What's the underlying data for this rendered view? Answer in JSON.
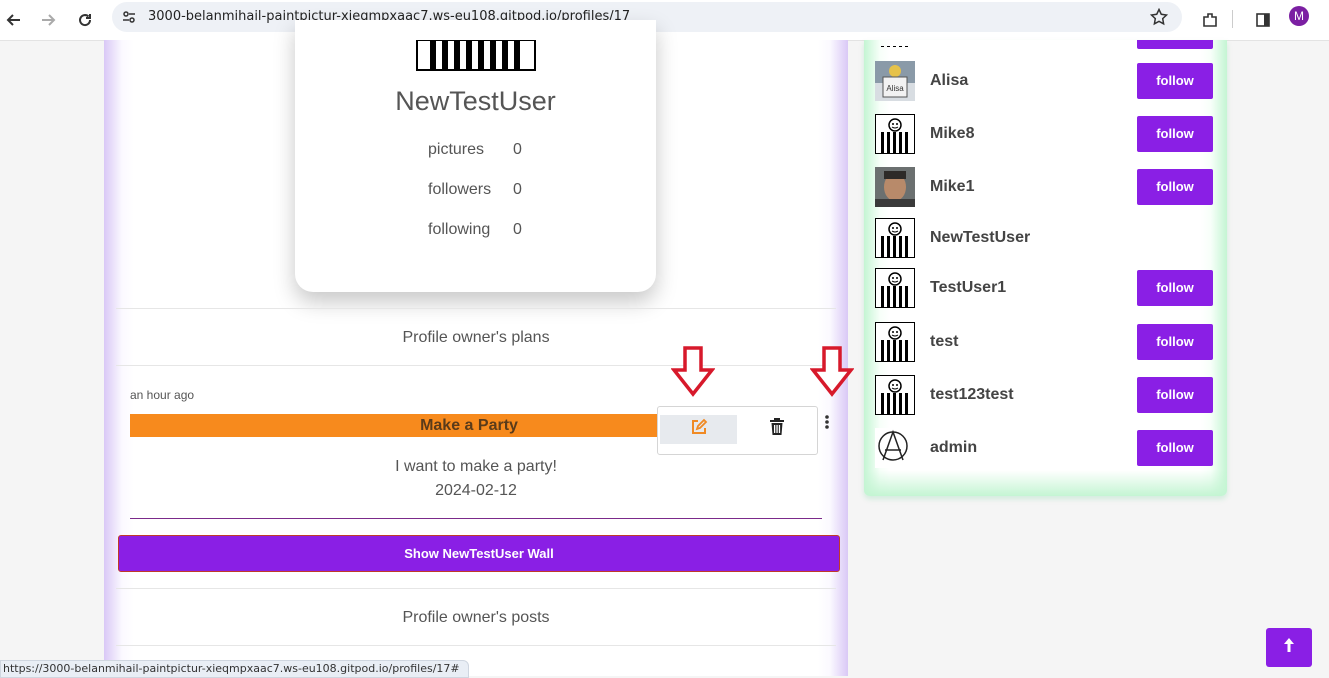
{
  "browser": {
    "url": "3000-belanmihail-paintpictur-xieqmpxaac7.ws-eu108.gitpod.io/profiles/17",
    "profile_initial": "M",
    "status_url": "https://3000-belanmihail-paintpictur-xieqmpxaac7.ws-eu108.gitpod.io/profiles/17#"
  },
  "profile": {
    "name": "NewTestUser",
    "stats": [
      {
        "label": "pictures",
        "value": "0"
      },
      {
        "label": "followers",
        "value": "0"
      },
      {
        "label": "following",
        "value": "0"
      }
    ]
  },
  "sections": {
    "plans_title": "Profile owner's plans",
    "posts_title": "Profile owner's posts"
  },
  "plan": {
    "time": "an hour ago",
    "title": "Make a Party",
    "description": "I want to make a party!",
    "date": "2024-02-12"
  },
  "wall_button": "Show NewTestUser Wall",
  "users": [
    {
      "name": "Alisa",
      "avatar": "alisa-photo",
      "follow": "follow"
    },
    {
      "name": "Mike8",
      "avatar": "stick-figure",
      "follow": "follow"
    },
    {
      "name": "Mike1",
      "avatar": "man-photo",
      "follow": "follow"
    },
    {
      "name": "NewTestUser",
      "avatar": "stick-figure",
      "follow": ""
    },
    {
      "name": "TestUser1",
      "avatar": "stick-figure",
      "follow": "follow"
    },
    {
      "name": "test",
      "avatar": "stick-figure",
      "follow": "follow"
    },
    {
      "name": "test123test",
      "avatar": "stick-figure",
      "follow": "follow"
    },
    {
      "name": "admin",
      "avatar": "anarchy-symbol",
      "follow": "follow"
    }
  ],
  "colors": {
    "accent": "#8a1fe5",
    "plan_bar": "#f78a1d",
    "annotation_arrow": "#d7192b"
  }
}
